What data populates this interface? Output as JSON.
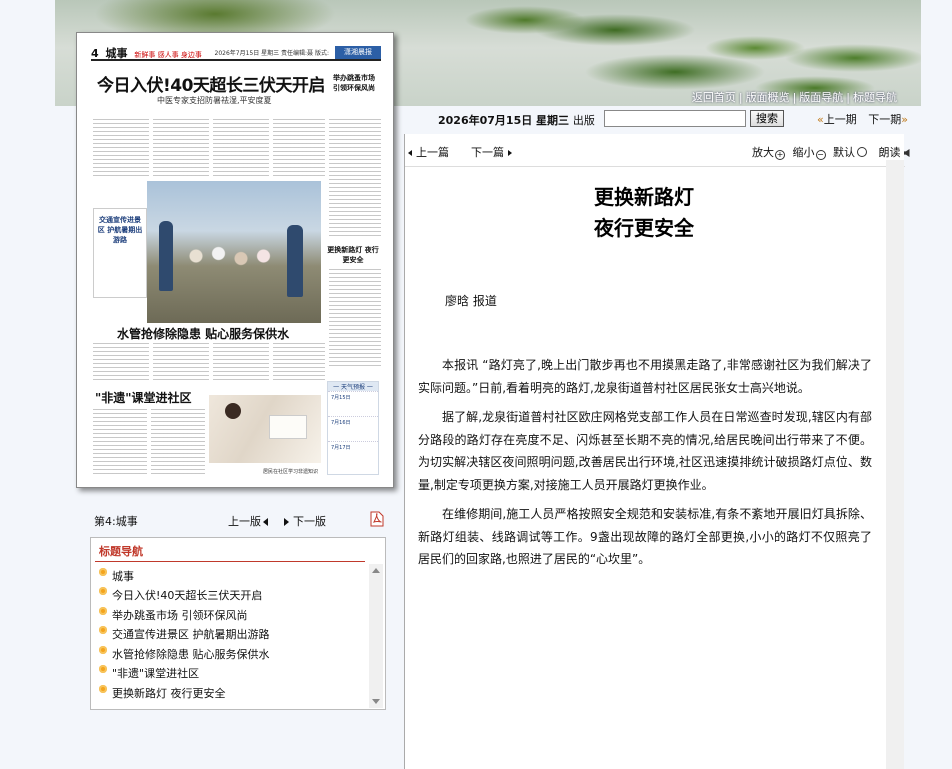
{
  "banner": {
    "nav": [
      "返回首页",
      "版面概览",
      "版面导航",
      "标题导航"
    ]
  },
  "paper_thumb": {
    "page_num": "4",
    "section": "城事",
    "slogan": "新鲜事 感人事 身边事",
    "date_line": "2026年7月15日 星期三 责任编辑:聂 版式:",
    "logo": "潇湘晨报",
    "headline1": "今日入伏!40天超长三伏天开启",
    "sub1": "中医专家支招防暑祛湿,平安度夏",
    "side1": "举办跳蚤市场 引领环保风尚",
    "box2": "交通宣传进景区 护航暑期出游路",
    "side2": "更换新路灯 夜行更安全",
    "headline2": "水管抢修除隐患 贴心服务保供水",
    "headline3": "\"非遗\"课堂进社区",
    "weather_title": "一 天气预报 一",
    "weather": [
      "7月15日",
      "7月16日",
      "7月17日"
    ],
    "foot": "居民在社区学习非遗知识"
  },
  "page_nav": {
    "page_name": "第4:城事",
    "prev": "上一版",
    "next": "下一版"
  },
  "title_nav": {
    "title": "标题导航",
    "items": [
      "城事",
      "今日入伏!40天超长三伏天开启",
      "举办跳蚤市场 引领环保风尚",
      "交通宣传进景区 护航暑期出游路",
      "水管抢修除隐患 贴心服务保供水",
      "\"非遗\"课堂进社区",
      "更换新路灯 夜行更安全"
    ]
  },
  "toolbar": {
    "date": "2026年07月15日 星期三",
    "published": "出版",
    "search_value": "",
    "search_button": "搜索",
    "prev_issue": "上一期",
    "next_issue": "下一期"
  },
  "article_tools": {
    "prev": "上一篇",
    "next": "下一篇",
    "zoom_in": "放大",
    "zoom_out": "缩小",
    "default": "默认",
    "read_aloud": "朗读"
  },
  "article": {
    "title_line1": "更换新路灯",
    "title_line2": "夜行更安全",
    "author": "廖晗 报道",
    "paragraphs": [
      "本报讯 “路灯亮了,晚上出门散步再也不用摸黑走路了,非常感谢社区为我们解决了实际问题。”日前,看着明亮的路灯,龙泉街道普村社区居民张女士高兴地说。",
      "据了解,龙泉街道普村社区欧庄网格党支部工作人员在日常巡查时发现,辖区内有部分路段的路灯存在亮度不足、闪烁甚至长期不亮的情况,给居民晚间出行带来了不便。为切实解决辖区夜间照明问题,改善居民出行环境,社区迅速摸排统计破损路灯点位、数量,制定专项更换方案,对接施工人员开展路灯更换作业。",
      "在维修期间,施工人员严格按照安全规范和安装标准,有条不紊地开展旧灯具拆除、新路灯组装、线路调试等工作。9盏出现故障的路灯全部更换,小小的路灯不仅照亮了居民们的回家路,也照进了居民的“心坎里”。"
    ]
  }
}
